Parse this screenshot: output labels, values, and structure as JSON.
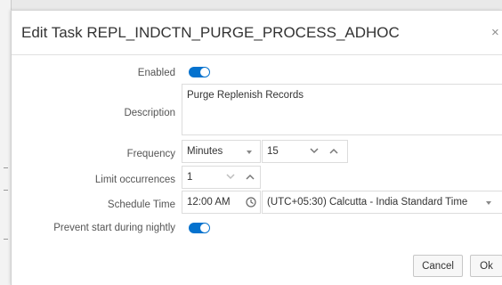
{
  "dialog": {
    "title": "Edit Task REPL_INDCTN_PURGE_PROCESS_ADHOC",
    "close_glyph": "×"
  },
  "form": {
    "enabled": {
      "label": "Enabled",
      "on": true
    },
    "description": {
      "label": "Description",
      "value": "Purge Replenish Records"
    },
    "frequency": {
      "label": "Frequency",
      "unit": "Minutes",
      "value": "15"
    },
    "limit_occurrences": {
      "label": "Limit occurrences",
      "value": "1"
    },
    "schedule_time": {
      "label": "Schedule Time",
      "time": "12:00 AM",
      "timezone": "(UTC+05:30) Calcutta - India Standard Time"
    },
    "prevent_start": {
      "label": "Prevent start during nightly",
      "on": true
    }
  },
  "buttons": {
    "cancel": "Cancel",
    "ok": "Ok"
  },
  "colors": {
    "accent": "#0572ce",
    "border": "#dcdcdc"
  }
}
